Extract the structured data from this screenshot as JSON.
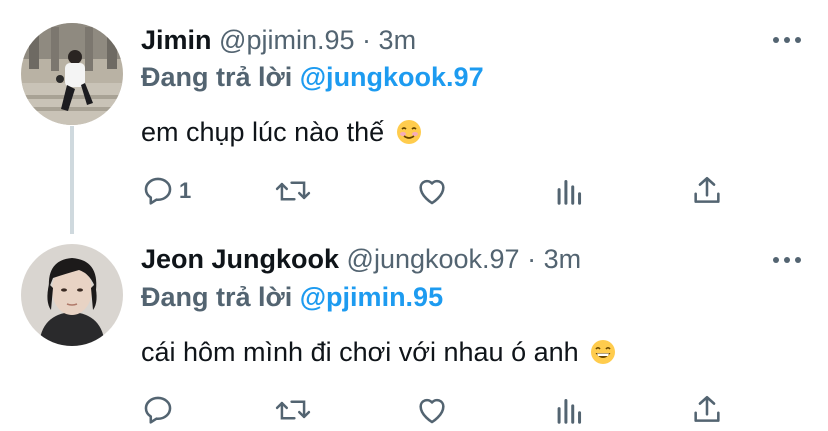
{
  "tweets": [
    {
      "name": "Jimin",
      "handle": "@pjimin.95",
      "separator": "·",
      "time": "3m",
      "reply_prefix": "Đang trả lời",
      "reply_to": "@jungkook.97",
      "text": "em chụp lúc nào thế",
      "emoji": "smiling-face-emoji",
      "actions": {
        "reply_count": "1",
        "retweet_count": "",
        "like_count": ""
      }
    },
    {
      "name": "Jeon Jungkook",
      "handle": "@jungkook.97",
      "separator": "·",
      "time": "3m",
      "reply_prefix": "Đang trả lời",
      "reply_to": "@pjimin.95",
      "text": "cái hôm mình đi chơi với nhau ó anh",
      "emoji": "grinning-face-emoji",
      "actions": {
        "reply_count": "",
        "retweet_count": "",
        "like_count": ""
      }
    }
  ],
  "colors": {
    "accent": "#1d9bf0",
    "secondary": "#536471",
    "primary": "#0f1419",
    "thread": "#cfd9de"
  }
}
